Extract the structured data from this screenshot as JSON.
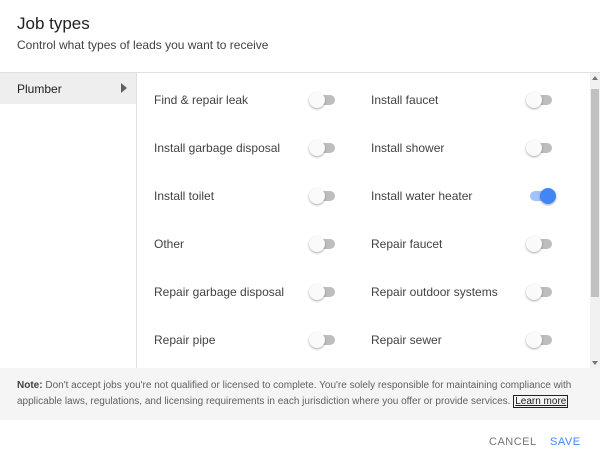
{
  "dialog": {
    "title": "Job types",
    "subtitle": "Control what types of leads you want to receive"
  },
  "sidebar": {
    "items": [
      {
        "label": "Plumber",
        "selected": true
      }
    ]
  },
  "jobs": [
    {
      "label": "Find & repair leak",
      "enabled": false
    },
    {
      "label": "Install faucet",
      "enabled": false
    },
    {
      "label": "Install garbage disposal",
      "enabled": false
    },
    {
      "label": "Install shower",
      "enabled": false
    },
    {
      "label": "Install toilet",
      "enabled": false
    },
    {
      "label": "Install water heater",
      "enabled": true
    },
    {
      "label": "Other",
      "enabled": false
    },
    {
      "label": "Repair faucet",
      "enabled": false
    },
    {
      "label": "Repair garbage disposal",
      "enabled": false
    },
    {
      "label": "Repair outdoor systems",
      "enabled": false
    },
    {
      "label": "Repair pipe",
      "enabled": false
    },
    {
      "label": "Repair sewer",
      "enabled": false
    }
  ],
  "note": {
    "prefix": "Note:",
    "text": "Don't accept jobs you're not qualified or licensed to complete. You're solely responsible for maintaining compliance with applicable laws, regulations, and licensing requirements in each jurisdiction where you offer or provide services.",
    "link": "Learn more"
  },
  "footer": {
    "cancel_label": "CANCEL",
    "save_label": "SAVE"
  },
  "colors": {
    "accent": "#4285f4",
    "toggle_on_track": "#a1c2fa",
    "toggle_off_track": "#bdbdbd"
  }
}
